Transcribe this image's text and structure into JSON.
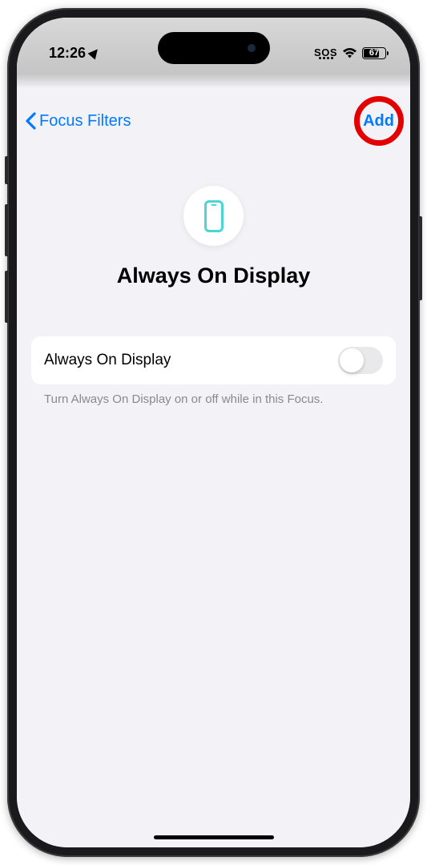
{
  "status": {
    "time": "12:26",
    "sos": "SOS",
    "battery": "67"
  },
  "nav": {
    "back_label": "Focus Filters",
    "add_label": "Add"
  },
  "hero": {
    "title": "Always On Display"
  },
  "setting": {
    "label": "Always On Display",
    "description": "Turn Always On Display on or off while in this Focus."
  }
}
